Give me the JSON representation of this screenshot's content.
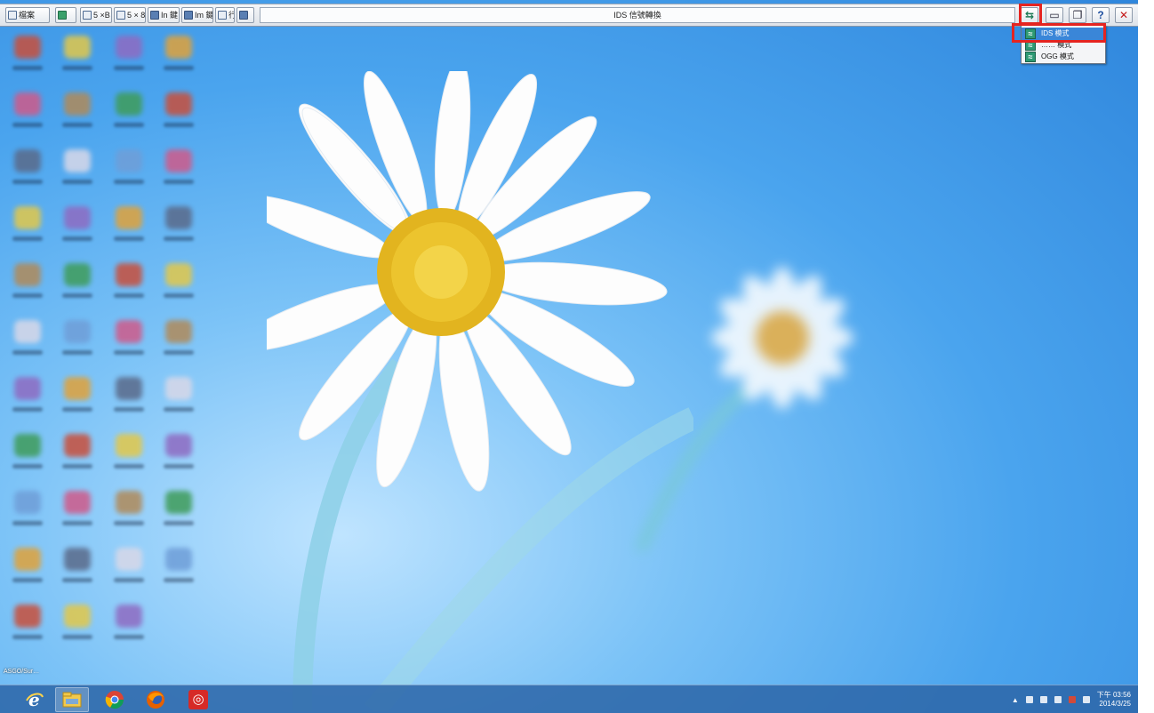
{
  "toolbar": {
    "title": "IDS 信號轉換",
    "buttons": [
      {
        "icon": "document-icon",
        "label": "檔案"
      },
      {
        "icon": "open-icon",
        "label": ""
      },
      {
        "icon": "split-icon",
        "label": "5 ×B"
      },
      {
        "icon": "split-icon",
        "label": "5 × 8"
      },
      {
        "icon": "channel-icon",
        "label": "In 鍵"
      },
      {
        "icon": "channel-icon",
        "label": "Im 鍵"
      },
      {
        "icon": "tile-icon",
        "label": "行"
      },
      {
        "icon": "capture-icon",
        "label": ""
      }
    ],
    "right_buttons": [
      {
        "icon": "convert-icon",
        "label": "⇆"
      },
      {
        "icon": "window-icon",
        "label": "▭"
      },
      {
        "icon": "restore-icon",
        "label": "❐"
      },
      {
        "icon": "help-icon",
        "label": "?"
      },
      {
        "icon": "close-icon",
        "label": "✕"
      }
    ]
  },
  "dropdown": {
    "items": [
      {
        "label": "IDS 模式",
        "icon": "ids-icon",
        "selected": true
      },
      {
        "label": "…… 模式",
        "icon": "mode-icon",
        "selected": false
      },
      {
        "label": "OGG 模式",
        "icon": "ogg-icon",
        "selected": false
      }
    ]
  },
  "desktop": {
    "bottom_icon_label": "ASGO/Sur…"
  },
  "taskbar": {
    "apps": [
      {
        "icon": "internet-explorer-icon",
        "glyph": "e"
      },
      {
        "icon": "file-explorer-icon",
        "glyph": ""
      },
      {
        "icon": "chrome-icon",
        "glyph": ""
      },
      {
        "icon": "firefox-icon",
        "glyph": ""
      },
      {
        "icon": "netease-music-icon",
        "glyph": "◎"
      }
    ],
    "clock_time": "下午 03:56",
    "clock_date": "2014/3/25"
  },
  "colors": {
    "highlight": "#e52420",
    "taskbar": "#2e68aa",
    "sky": "#4aa4ee"
  }
}
